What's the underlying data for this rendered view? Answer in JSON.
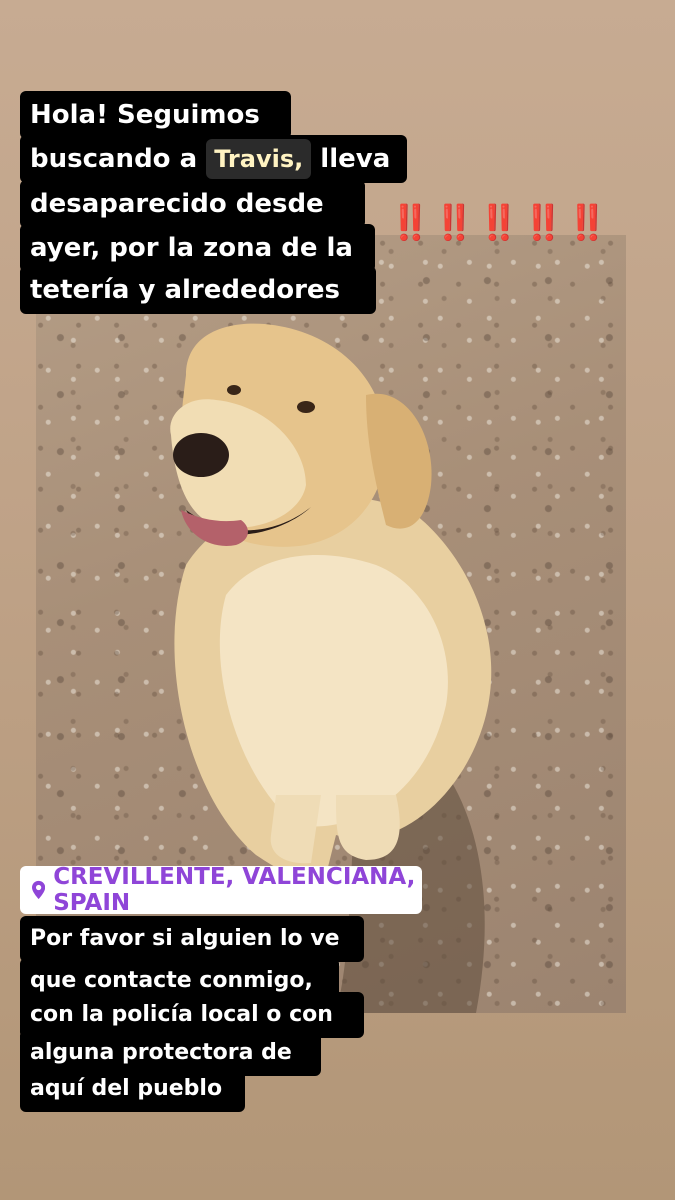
{
  "story": {
    "intro": {
      "line1": "Hola! Seguimos",
      "line2_prefix": "buscando a ",
      "dog_name": "Travis,",
      "line2_suffix": "lleva",
      "line3": "desaparecido desde",
      "line4": "ayer, por la zona de la",
      "line5": "tetería y alrededores"
    },
    "alarm_emoji": "‼️‼️‼️‼️‼️",
    "location": {
      "icon": "location-pin-icon",
      "label": "CREVILLENTE, VALENCIANA, SPAIN",
      "color": "#8f45d8"
    },
    "request": {
      "line1": "Por favor si alguien lo ve",
      "line2": "que contacte conmigo,",
      "line3": "con la policía local o con",
      "line4": "alguna protectora de",
      "line5": "aquí del pueblo"
    },
    "photo": {
      "subject": "golden retriever dog sitting on dirt ground"
    }
  }
}
